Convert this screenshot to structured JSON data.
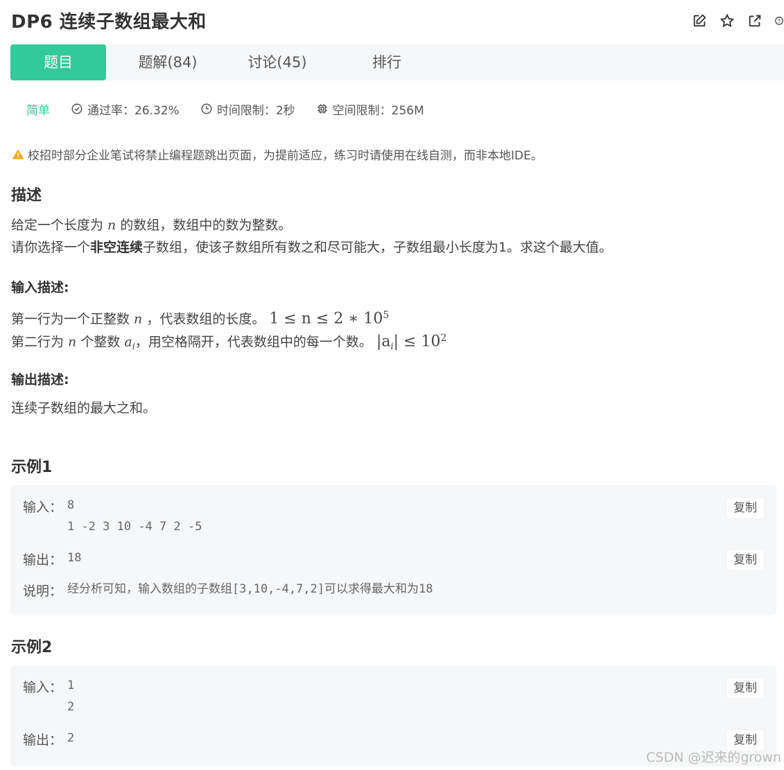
{
  "problem": {
    "title": "DP6  连续子数组最大和",
    "actions": [
      "edit-icon",
      "star-icon",
      "external-link-icon",
      "alert-icon"
    ]
  },
  "tabs": [
    {
      "label": "题目",
      "active": true
    },
    {
      "label": "题解(84)",
      "active": false
    },
    {
      "label": "讨论(45)",
      "active": false
    },
    {
      "label": "排行",
      "active": false
    }
  ],
  "meta": {
    "difficulty": "简单",
    "pass_rate": "通过率：26.32%",
    "time_limit": "时间限制：2秒",
    "space_limit": "空间限制：256M"
  },
  "warning": "校招时部分企业笔试将禁止编程题跳出页面，为提前适应，练习时请使用在线自测，而非本地IDE。",
  "description": {
    "heading": "描述",
    "line1_a": "给定一个长度为 ",
    "line1_var": "n",
    "line1_b": " 的数组，数组中的数为整数。",
    "line2_a": "请你选择一个",
    "line2_bold": "非空连续",
    "line2_b": "子数组，使该子数组所有数之和尽可能大，子数组最小长度为1。求这个最大值。"
  },
  "input_desc": {
    "heading": "输入描述:",
    "line1_a": "第一行为一个正整数 ",
    "line1_var": "n",
    "line1_b": " ，代表数组的长度。 ",
    "line1_math": "1 ≤ n ≤ 2 ∗ 10",
    "line1_exp": "5",
    "line2_a": "第二行为 ",
    "line2_var": "n",
    "line2_b": " 个整数 ",
    "line2_var2": "a",
    "line2_sub": "i",
    "line2_c": "，用空格隔开，代表数组中的每一个数。 ",
    "line2_math": "|a",
    "line2_math_sub": "i",
    "line2_math_b": "| ≤ 10",
    "line2_exp": "2"
  },
  "output_desc": {
    "heading": "输出描述:",
    "text": "连续子数组的最大之和。"
  },
  "examples": [
    {
      "heading": "示例1",
      "input_label": "输入：",
      "input": "8\n1 -2 3 10 -4 7 2 -5",
      "output_label": "输出：",
      "output": "18",
      "note_label": "说明：",
      "note": "经分析可知，输入数组的子数组[3,10,-4,7,2]可以求得最大和为18",
      "copy": "复制"
    },
    {
      "heading": "示例2",
      "input_label": "输入：",
      "input": "1\n2",
      "output_label": "输出：",
      "output": "2",
      "copy": "复制"
    }
  ],
  "watermark": "CSDN @迟来的grown",
  "colors": {
    "accent": "#32ca99",
    "warning": "#f5a623"
  }
}
